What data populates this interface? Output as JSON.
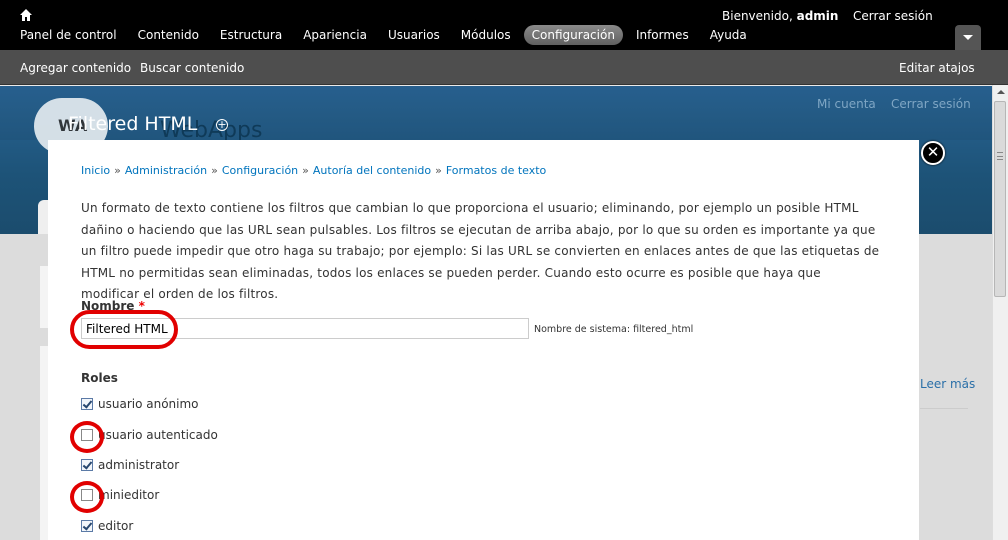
{
  "toolbar": {
    "welcome_prefix": "Bienvenido,",
    "username": "admin",
    "logout": "Cerrar sesión",
    "menu": [
      "Panel de control",
      "Contenido",
      "Estructura",
      "Apariencia",
      "Usuarios",
      "Módulos",
      "Configuración",
      "Informes",
      "Ayuda"
    ],
    "active_menu": "Configuración",
    "shortcuts": [
      "Agregar contenido",
      "Buscar contenido"
    ],
    "edit_shortcuts": "Editar atajos"
  },
  "background_page": {
    "site_name": "WebApps",
    "logo_text": "WA",
    "my_account": "Mi cuenta",
    "logout": "Cerrar sesión",
    "read_more": "Leer más"
  },
  "page": {
    "title": "Filtered HTML"
  },
  "breadcrumb": [
    "Inicio",
    "Administración",
    "Configuración",
    "Autoría del contenido",
    "Formatos de texto"
  ],
  "breadcrumb_separator": "»",
  "description": "Un formato de texto contiene los filtros que cambian lo que proporciona el usuario; eliminando, por ejemplo un posible HTML dañino o haciendo que las URL sean pulsables. Los filtros se ejecutan de arriba abajo, por lo que su orden es importante ya que un filtro puede impedir que otro haga su trabajo; por ejemplo: Si las URL se convierten en enlaces antes de que las etiquetas de HTML no permitidas sean eliminadas, todos los enlaces se pueden perder. Cuando esto ocurre es posible que haya que modificar el orden de los filtros.",
  "form": {
    "name_label": "Nombre",
    "required_mark": "*",
    "name_value": "Filtered HTML",
    "machine_name": "Nombre de sistema: filtered_html",
    "roles_title": "Roles",
    "roles": [
      {
        "label": "usuario anónimo",
        "checked": true
      },
      {
        "label": "usuario autenticado",
        "checked": false
      },
      {
        "label": "administrator",
        "checked": true
      },
      {
        "label": "minieditor",
        "checked": false
      },
      {
        "label": "editor",
        "checked": true
      }
    ]
  },
  "colors": {
    "toolbar": "#000000",
    "shortcuts_bar": "#4e4e4e",
    "header_blue": "#1d5378",
    "link": "#0074bd",
    "highlight_ring": "#e10000",
    "required": "#ee0000"
  },
  "icons": {
    "home": "home-icon",
    "add_shortcut": "plus-circle-icon",
    "close": "close-icon",
    "toggle": "chevron-down-icon"
  }
}
